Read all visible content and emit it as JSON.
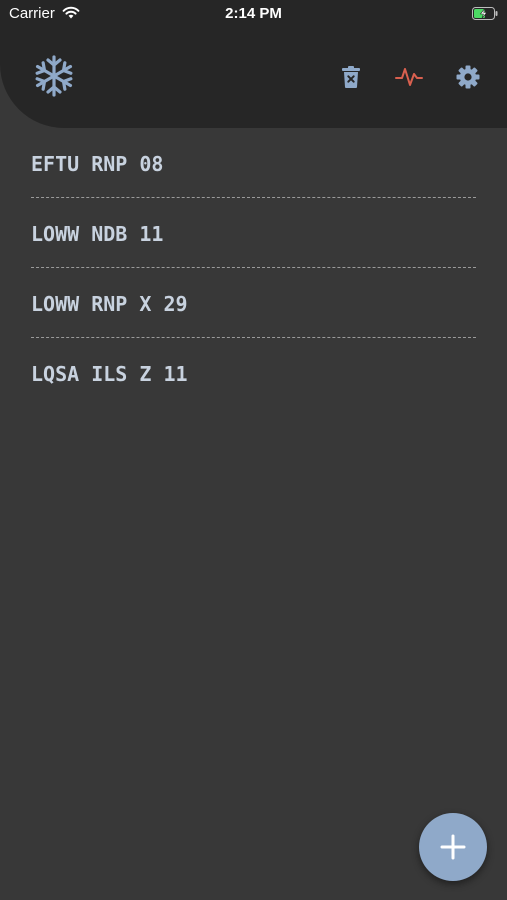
{
  "status_bar": {
    "carrier": "Carrier",
    "time": "2:14 PM"
  },
  "header": {
    "logo_icon": "snowflake-icon",
    "actions": [
      {
        "icon": "trash-icon",
        "color": "#8fa9c9"
      },
      {
        "icon": "pulse-icon",
        "color": "#d9604f"
      },
      {
        "icon": "gear-icon",
        "color": "#8fa9c9"
      }
    ]
  },
  "approaches": [
    {
      "label": "EFTU RNP 08"
    },
    {
      "label": "LOWW NDB 11"
    },
    {
      "label": "LOWW RNP X 29"
    },
    {
      "label": "LQSA ILS Z 11"
    }
  ],
  "fab": {
    "icon": "plus-icon"
  },
  "colors": {
    "background": "#383838",
    "header": "#262626",
    "accent": "#8fa9c9",
    "alert": "#d9604f",
    "text": "#c8d2df"
  }
}
